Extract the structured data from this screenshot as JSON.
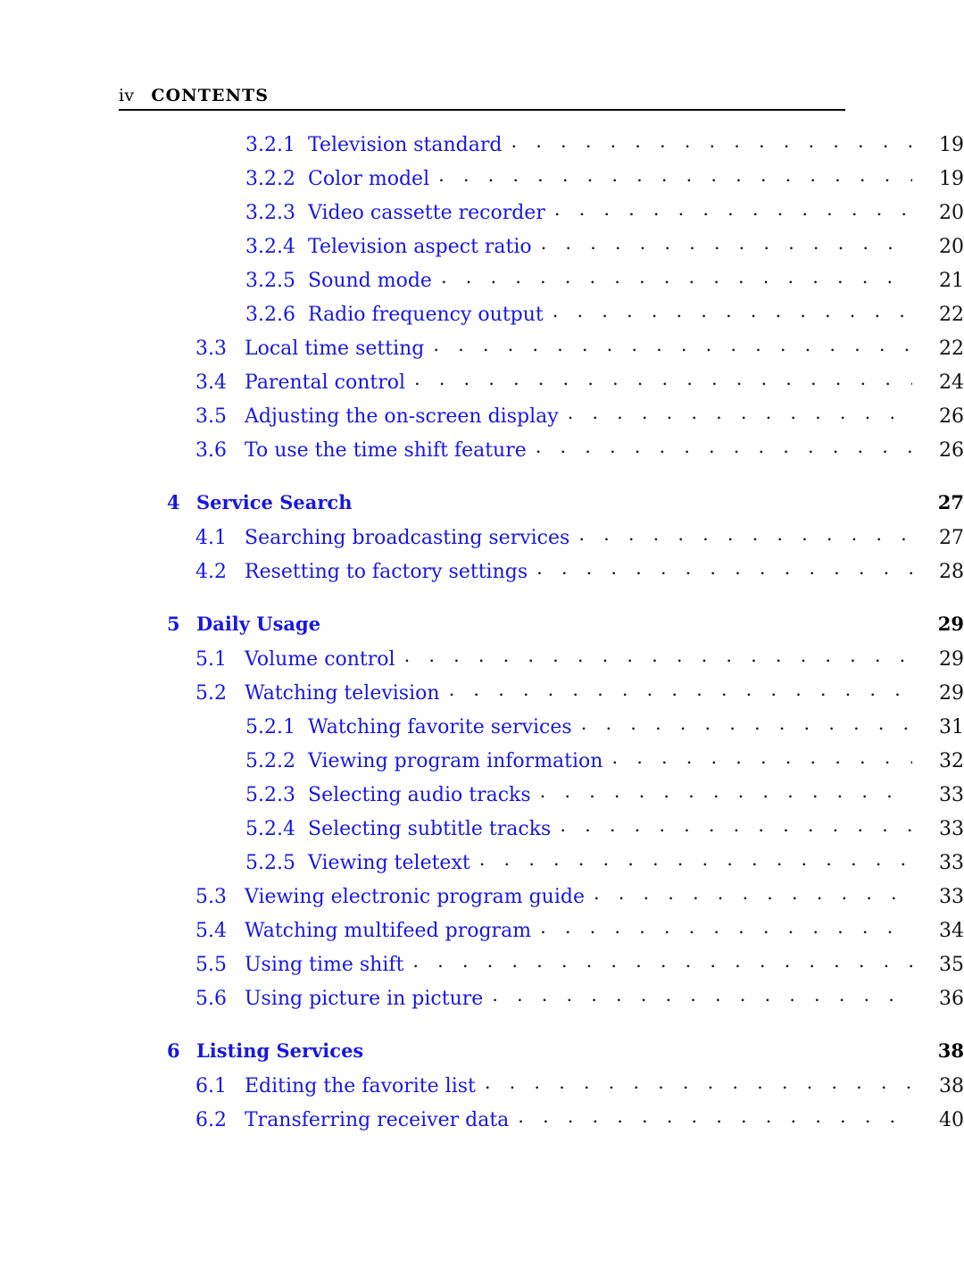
{
  "page": {
    "folio": "iv",
    "running_title": "CONTENTS",
    "accent_color": "#1717e2",
    "text_color": "#000000",
    "background_color": "#ffffff"
  },
  "toc": {
    "entries": [
      {
        "level": "subsection",
        "number": "3.2.1",
        "title": "Television standard",
        "page": "19"
      },
      {
        "level": "subsection",
        "number": "3.2.2",
        "title": "Color model",
        "page": "19"
      },
      {
        "level": "subsection",
        "number": "3.2.3",
        "title": "Video cassette recorder",
        "page": "20"
      },
      {
        "level": "subsection",
        "number": "3.2.4",
        "title": "Television aspect ratio",
        "page": "20"
      },
      {
        "level": "subsection",
        "number": "3.2.5",
        "title": "Sound mode",
        "page": "21"
      },
      {
        "level": "subsection",
        "number": "3.2.6",
        "title": "Radio frequency output",
        "page": "22"
      },
      {
        "level": "section",
        "number": "3.3",
        "title": "Local time setting",
        "page": "22"
      },
      {
        "level": "section",
        "number": "3.4",
        "title": "Parental control",
        "page": "24"
      },
      {
        "level": "section",
        "number": "3.5",
        "title": "Adjusting the on-screen display",
        "page": "26"
      },
      {
        "level": "section",
        "number": "3.6",
        "title": "To use the time shift feature",
        "page": "26"
      },
      {
        "level": "chapter",
        "number": "4",
        "title": "Service Search",
        "page": "27",
        "gap_before": true
      },
      {
        "level": "section",
        "number": "4.1",
        "title": "Searching broadcasting services",
        "page": "27"
      },
      {
        "level": "section",
        "number": "4.2",
        "title": "Resetting to factory settings",
        "page": "28"
      },
      {
        "level": "chapter",
        "number": "5",
        "title": "Daily Usage",
        "page": "29",
        "gap_before": true
      },
      {
        "level": "section",
        "number": "5.1",
        "title": "Volume control",
        "page": "29"
      },
      {
        "level": "section",
        "number": "5.2",
        "title": "Watching television",
        "page": "29"
      },
      {
        "level": "subsection",
        "number": "5.2.1",
        "title": "Watching favorite services",
        "page": "31"
      },
      {
        "level": "subsection",
        "number": "5.2.2",
        "title": "Viewing program information",
        "page": "32"
      },
      {
        "level": "subsection",
        "number": "5.2.3",
        "title": "Selecting audio tracks",
        "page": "33"
      },
      {
        "level": "subsection",
        "number": "5.2.4",
        "title": "Selecting subtitle tracks",
        "page": "33"
      },
      {
        "level": "subsection",
        "number": "5.2.5",
        "title": "Viewing teletext",
        "page": "33"
      },
      {
        "level": "section",
        "number": "5.3",
        "title": "Viewing electronic program guide",
        "page": "33"
      },
      {
        "level": "section",
        "number": "5.4",
        "title": "Watching multifeed program",
        "page": "34"
      },
      {
        "level": "section",
        "number": "5.5",
        "title": "Using time shift",
        "page": "35"
      },
      {
        "level": "section",
        "number": "5.6",
        "title": "Using picture in picture",
        "page": "36"
      },
      {
        "level": "chapter",
        "number": "6",
        "title": "Listing Services",
        "page": "38",
        "gap_before": true
      },
      {
        "level": "section",
        "number": "6.1",
        "title": "Editing the favorite list",
        "page": "38"
      },
      {
        "level": "section",
        "number": "6.2",
        "title": "Transferring receiver data",
        "page": "40"
      }
    ]
  }
}
